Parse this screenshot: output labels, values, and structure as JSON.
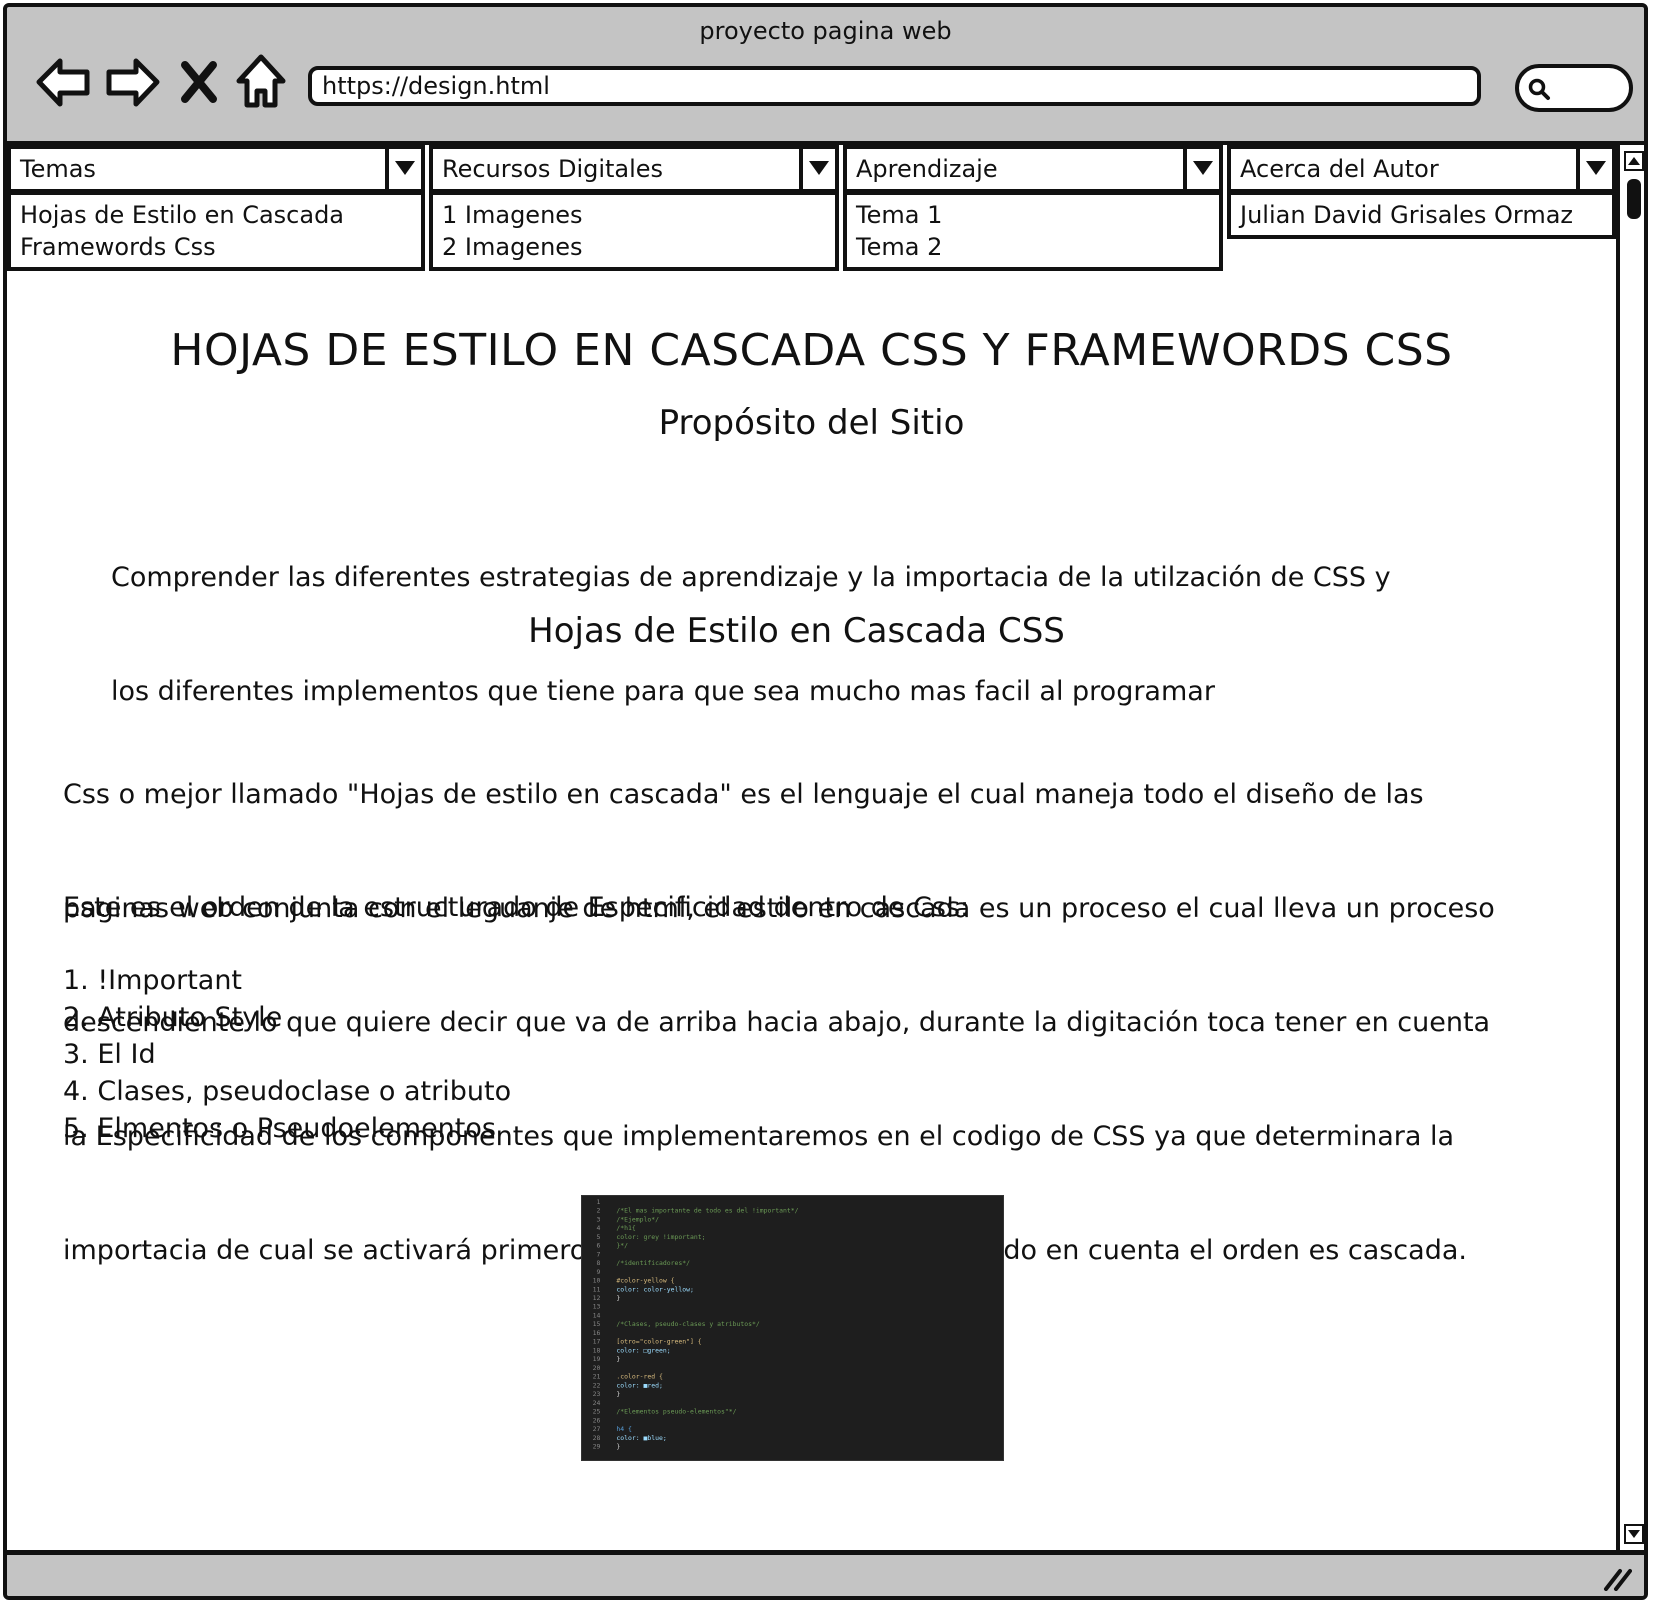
{
  "window": {
    "title": "proyecto pagina web"
  },
  "browser": {
    "url": "https://design.html",
    "nav": [
      {
        "name": "back-button",
        "icon": "arrow-left-icon"
      },
      {
        "name": "forward-button",
        "icon": "arrow-right-icon"
      },
      {
        "name": "stop-button",
        "icon": "close-icon"
      },
      {
        "name": "home-button",
        "icon": "home-icon"
      }
    ],
    "search_icon": "search-icon"
  },
  "menus": [
    {
      "label": "Temas",
      "items": [
        "Hojas de Estilo en Cascada",
        "Framewords Css"
      ]
    },
    {
      "label": "Recursos Digitales",
      "items": [
        "1 Imagenes",
        "2 Imagenes"
      ]
    },
    {
      "label": "Aprendizaje",
      "items": [
        "Tema 1",
        "Tema 2"
      ]
    },
    {
      "label": "Acerca del Autor",
      "items": [
        "Julian David Grisales Ormaz"
      ]
    }
  ],
  "page": {
    "title": "HOJAS DE ESTILO EN CASCADA CSS Y FRAMEWORDS CSS",
    "purpose_heading": "Propósito del Sitio",
    "purpose_lines": [
      "Comprender las diferentes estrategias de aprendizaje y la importacia de la utilzación de CSS y",
      "los diferentes implementos que tiene para que sea mucho mas facil al programar"
    ],
    "css_heading": "Hojas de Estilo en Cascada CSS",
    "css_lines": [
      "Css o mejor llamado \"Hojas de estilo en cascada\" es el lenguaje el cual maneja todo el diseño de las",
      "paginas web conjunta con el leguanje de html, el estilo en cascada es un proceso el cual lleva un proceso",
      "descendiente lo que quiere decir que va de arriba hacia abajo, durante la digitación toca tener en cuenta",
      "la Especificidad de los componentes que implementaremos en el codigo de CSS ya que determinara la",
      "importacia de cual se activará primero antes que otro siempre teniendo en cuenta el orden es cascada."
    ],
    "order_intro": "Este es el orden de la estructurado de Especificidad dentro de Css:",
    "order_items": [
      "1. !Important",
      "2. Atributo Style",
      "3. El Id",
      "4. Clases, pseudoclase o atributo",
      "5. Elmentos o Pseudoelementos"
    ]
  },
  "code_image": {
    "lines": [
      {
        "n": "1",
        "t": "",
        "c": "#d4d4d4"
      },
      {
        "n": "2",
        "t": "/*El mas importante de todo es del !important*/",
        "c": "#6a9955"
      },
      {
        "n": "3",
        "t": "/*Ejemplo*/",
        "c": "#6a9955"
      },
      {
        "n": "4",
        "t": "/*h1{",
        "c": "#6a9955"
      },
      {
        "n": "5",
        "t": "    color: grey !important;",
        "c": "#6a9955"
      },
      {
        "n": "6",
        "t": "}*/",
        "c": "#6a9955"
      },
      {
        "n": "7",
        "t": "",
        "c": "#d4d4d4"
      },
      {
        "n": "8",
        "t": "/*identificadores*/",
        "c": "#6a9955"
      },
      {
        "n": "9",
        "t": "",
        "c": "#d4d4d4"
      },
      {
        "n": "10",
        "t": "#color-yellow {",
        "c": "#d7ba7d"
      },
      {
        "n": "11",
        "t": "    color: color-yellow;",
        "c": "#9cdcfe"
      },
      {
        "n": "12",
        "t": "}",
        "c": "#d4d4d4"
      },
      {
        "n": "13",
        "t": "",
        "c": "#d4d4d4"
      },
      {
        "n": "14",
        "t": "",
        "c": "#d4d4d4"
      },
      {
        "n": "15",
        "t": "/*Clases, pseudo-clases y atributos*/",
        "c": "#6a9955"
      },
      {
        "n": "16",
        "t": "",
        "c": "#d4d4d4"
      },
      {
        "n": "17",
        "t": "[otro=\"color-green\"] {",
        "c": "#d7ba7d"
      },
      {
        "n": "18",
        "t": "    color: □green;",
        "c": "#9cdcfe"
      },
      {
        "n": "19",
        "t": "}",
        "c": "#d4d4d4"
      },
      {
        "n": "20",
        "t": "",
        "c": "#d4d4d4"
      },
      {
        "n": "21",
        "t": ".color-red {",
        "c": "#d7ba7d"
      },
      {
        "n": "22",
        "t": "    color: ■red;",
        "c": "#9cdcfe"
      },
      {
        "n": "23",
        "t": "}",
        "c": "#d4d4d4"
      },
      {
        "n": "24",
        "t": "",
        "c": "#d4d4d4"
      },
      {
        "n": "25",
        "t": "/*Elementos pseudo-elementos\"*/",
        "c": "#6a9955"
      },
      {
        "n": "26",
        "t": "",
        "c": "#d4d4d4"
      },
      {
        "n": "27",
        "t": "h4 {",
        "c": "#569cd6"
      },
      {
        "n": "28",
        "t": "    color: ■blue;",
        "c": "#9cdcfe"
      },
      {
        "n": "29",
        "t": "}",
        "c": "#d4d4d4"
      }
    ]
  },
  "colors": {
    "chrome": "#c4c4c4",
    "ink": "#111111",
    "page_bg": "#ffffff",
    "code_bg": "#1e1e1e"
  }
}
